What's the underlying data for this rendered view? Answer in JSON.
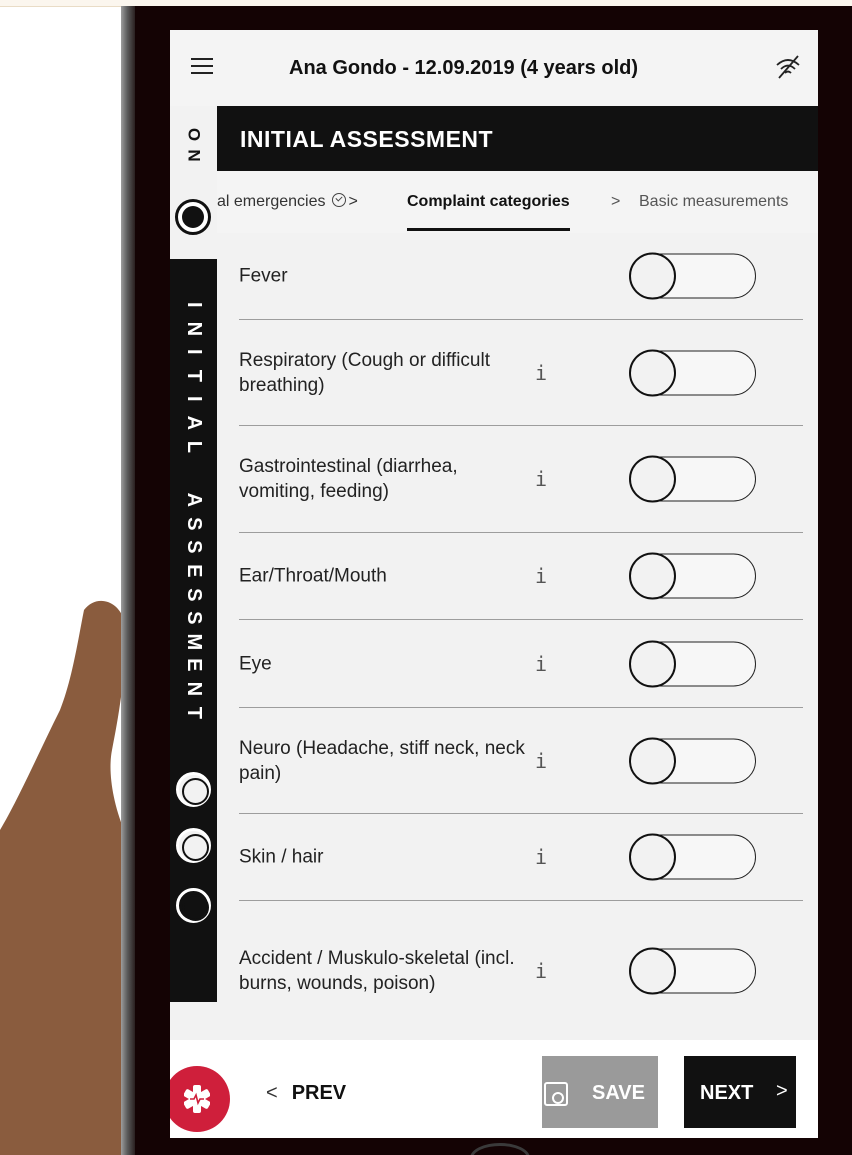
{
  "header": {
    "patient_title": "Ana Gondo  - 12.09.2019 (4 years old)",
    "menu_icon": "hamburger-menu-icon",
    "connection_icon": "wifi-off-icon"
  },
  "left_strip": {
    "top_letters": [
      "O",
      "N"
    ],
    "stage_letters": [
      "I",
      "N",
      "I",
      "T",
      "I",
      "A",
      "L",
      "",
      "A",
      "S",
      "S",
      "E",
      "S",
      "S",
      "M",
      "E",
      "N",
      "T"
    ]
  },
  "section": {
    "title": "INITIAL ASSESSMENT"
  },
  "steps": {
    "done_label": "al emergencies",
    "active_label": "Complaint categories",
    "next_label": "Basic measurements",
    "separator": ">"
  },
  "categories": [
    {
      "label": "Fever",
      "info": ""
    },
    {
      "label": "Respiratory (Cough or difficult breathing)",
      "info": "i"
    },
    {
      "label": "Gastrointestinal (diarrhea, vomiting, feeding)",
      "info": "i"
    },
    {
      "label": "Ear/Throat/Mouth",
      "info": "i"
    },
    {
      "label": "Eye",
      "info": "i"
    },
    {
      "label": "Neuro (Headache, stiff neck, neck pain)",
      "info": "i"
    },
    {
      "label": "Skin / hair",
      "info": "i"
    },
    {
      "label": "Accident / Muskulo-skeletal (incl. burns, wounds, poison)",
      "info": "i"
    }
  ],
  "footer": {
    "prev_label": "PREV",
    "prev_chevron": "<",
    "save_label": "SAVE",
    "next_label": "NEXT",
    "next_chevron": ">"
  },
  "colors": {
    "brand_red": "#cf1f3b",
    "dark": "#111111",
    "save_gray": "#9a9a9a"
  }
}
